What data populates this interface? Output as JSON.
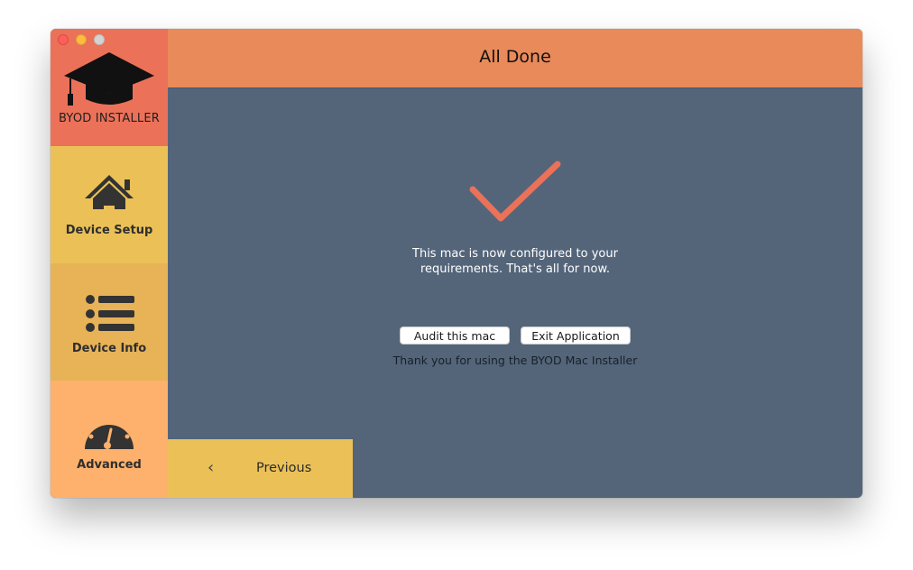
{
  "window": {
    "header_title": "All Done"
  },
  "sidebar": {
    "brand_label": "BYOD INSTALLER",
    "items": [
      {
        "label": "Device Setup",
        "icon": "home-icon"
      },
      {
        "label": "Device Info",
        "icon": "list-icon"
      },
      {
        "label": "Advanced",
        "icon": "gauge-icon"
      }
    ]
  },
  "main": {
    "message_line1": "This mac is now configured to your",
    "message_line2": "requirements. That's all for now.",
    "audit_button": "Audit this mac",
    "exit_button": "Exit Application",
    "thanks": "Thank you for using the BYOD Mac Installer"
  },
  "footer": {
    "previous_label": "Previous",
    "previous_icon": "chevron-left-icon"
  },
  "colors": {
    "brand": "#ec7159",
    "header": "#e98a5a",
    "setup": "#ebc157",
    "info": "#e8b257",
    "advanced": "#fdb16c",
    "content": "#54657a",
    "checkmark": "#ec7159"
  }
}
